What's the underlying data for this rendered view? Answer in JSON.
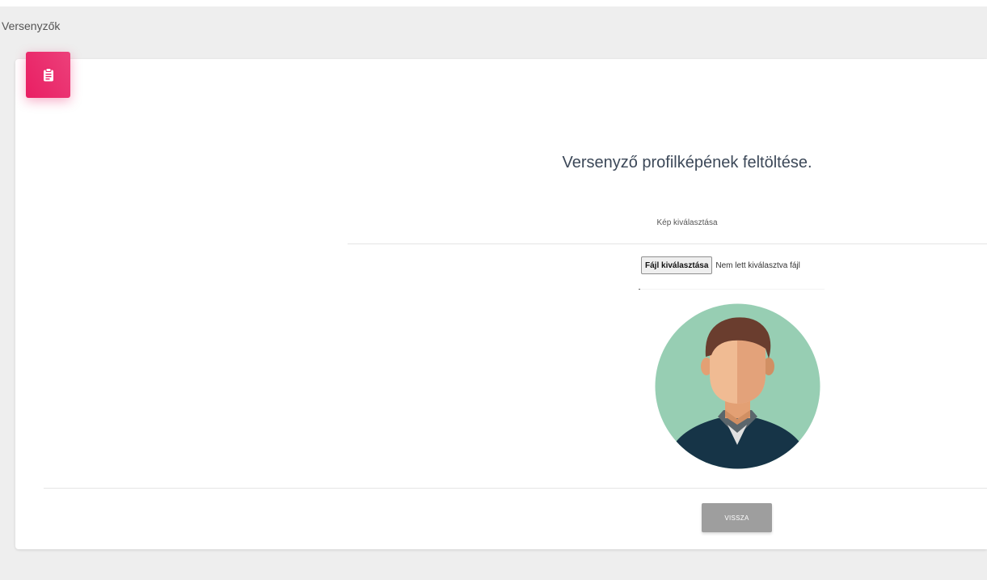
{
  "header": {
    "title": "Versenyzők"
  },
  "card": {
    "icon": "clipboard-icon",
    "accent_color": "#e91e63"
  },
  "upload": {
    "heading": "Versenyző profilképének feltöltése.",
    "select_label": "Kép kiválasztása",
    "file_button_label": "Fájl kiválasztása",
    "file_status": "Nem lett kiválasztva fájl",
    "avatar_image": "default-profile-avatar"
  },
  "footer": {
    "back_button_label": "VISSZA"
  }
}
